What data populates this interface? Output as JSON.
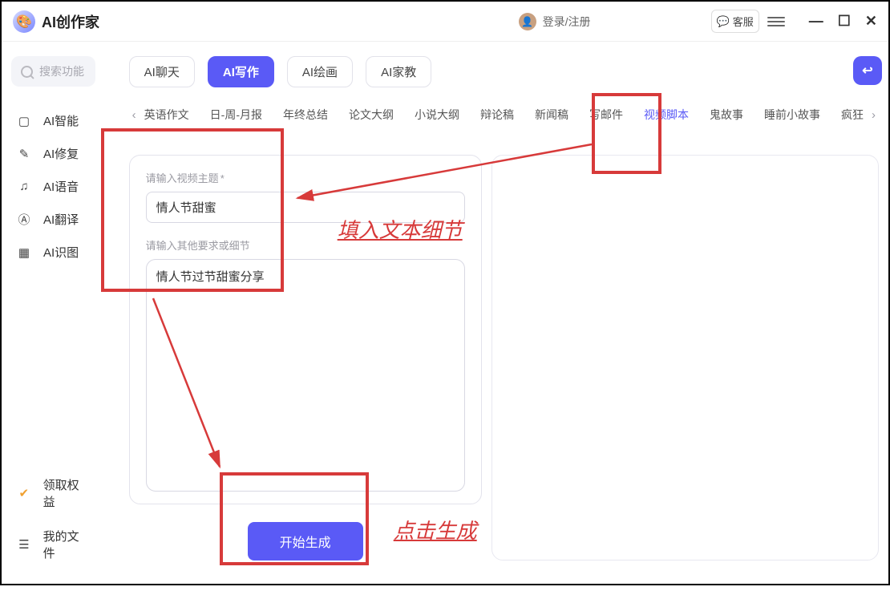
{
  "title": "AI创作家",
  "logo_emoji": "🎨",
  "login": "登录/注册",
  "customer_service": "客服",
  "search_placeholder": "搜索功能",
  "sidebar_items": [
    {
      "icon": "▢",
      "label": "AI智能"
    },
    {
      "icon": "✎",
      "label": "AI修复"
    },
    {
      "icon": "♫",
      "label": "AI语音"
    },
    {
      "icon": "Ⓐ",
      "label": "AI翻译"
    },
    {
      "icon": "▦",
      "label": "AI识图"
    }
  ],
  "sidebar_lower": [
    {
      "icon": "✔",
      "label": "领取权益",
      "color": "#f0a030"
    },
    {
      "icon": "☰",
      "label": "我的文件",
      "color": "#333"
    }
  ],
  "top_tabs": [
    {
      "label": "AI聊天",
      "active": false
    },
    {
      "label": "AI写作",
      "active": true
    },
    {
      "label": "AI绘画",
      "active": false
    },
    {
      "label": "AI家教",
      "active": false
    }
  ],
  "sub_tabs": [
    "英语作文",
    "日-周-月报",
    "年终总结",
    "论文大纲",
    "小说大纲",
    "辩论稿",
    "新闻稿",
    "写邮件",
    "视频脚本",
    "鬼故事",
    "睡前小故事",
    "疯狂"
  ],
  "sub_active_index": 8,
  "history_glyph": "↩",
  "form": {
    "topic_label": "请输入视频主题",
    "topic_required": "*",
    "topic_value": "情人节甜蜜",
    "detail_label": "请输入其他要求或细节",
    "detail_value": "情人节过节甜蜜分享",
    "generate": "开始生成"
  },
  "annotations": {
    "fill_text": "填入文本细节",
    "click_gen": "点击生成"
  },
  "win_controls": {
    "min": "—",
    "max": "☐",
    "close": "✕"
  }
}
